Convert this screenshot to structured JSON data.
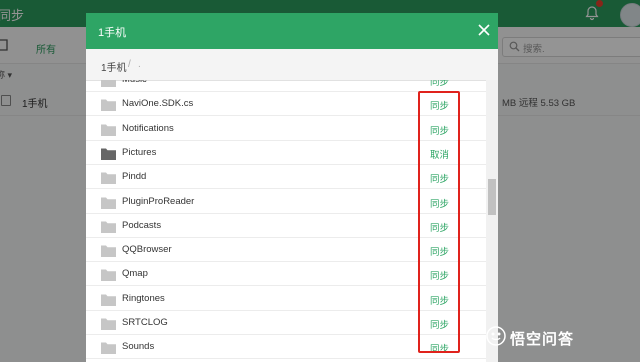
{
  "app": {
    "title": "同步",
    "tab_all": "所有",
    "search_placeholder": "搜索.",
    "column_header": "称 ▾",
    "row_name": "1手机",
    "row_size": "MB 远程 5.53 GB",
    "notification_count": 1
  },
  "modal": {
    "title": "1手机",
    "breadcrumb": {
      "root": "1手机",
      "separator": "/",
      "current": "."
    },
    "rows": [
      {
        "name": "Music",
        "action": "同步"
      },
      {
        "name": "NaviOne.SDK.cs",
        "action": "同步"
      },
      {
        "name": "Notifications",
        "action": "同步"
      },
      {
        "name": "Pictures",
        "action": "取消",
        "synced": true
      },
      {
        "name": "Pindd",
        "action": "同步"
      },
      {
        "name": "PluginProReader",
        "action": "同步"
      },
      {
        "name": "Podcasts",
        "action": "同步"
      },
      {
        "name": "QQBrowser",
        "action": "同步"
      },
      {
        "name": "Qmap",
        "action": "同步"
      },
      {
        "name": "Ringtones",
        "action": "同步"
      },
      {
        "name": "SRTCLOG",
        "action": "同步"
      },
      {
        "name": "Sounds",
        "action": "同步"
      }
    ]
  },
  "watermark": {
    "text": "悟空问答"
  },
  "colors": {
    "brand": "#2ea565",
    "app_header": "#2b9b5e",
    "highlight": "#e0221c",
    "folder": "#c6c6c6",
    "folder_active": "#666666"
  }
}
